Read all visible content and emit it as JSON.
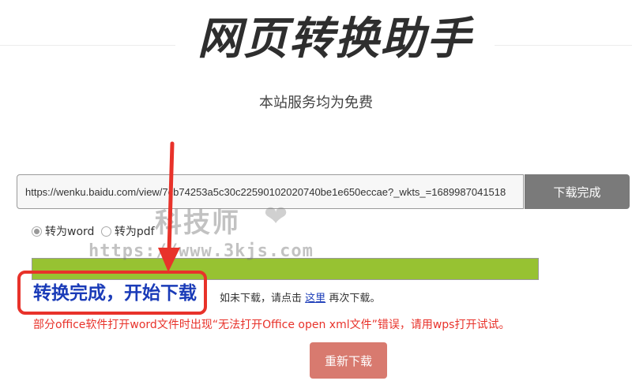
{
  "header": {
    "title": "网页转换助手",
    "subtitle": "本站服务均为免费"
  },
  "form": {
    "url_value": "https://wenku.baidu.com/view/7cb74253a5c30c22590102020740be1e650eccae?_wkts_=1689987041518",
    "download_label": "下载完成",
    "options": [
      {
        "label": "转为word",
        "checked": true
      },
      {
        "label": "转为pdf",
        "checked": false
      }
    ],
    "progress_fraction": 1.0
  },
  "result": {
    "done_text": "转换完成，开始下载",
    "retry_prefix": "如未下载，请点击",
    "retry_link": "这里",
    "retry_suffix": "再次下载。",
    "warning": "部分office软件打开word文件时出现“无法打开Office open xml文件”错误，请用wps打开试试。",
    "reload_label": "重新下载"
  },
  "watermark": {
    "text": "科技师",
    "heart": "❤",
    "url": "https://www.3kjs.com"
  },
  "colors": {
    "progress": "#97c232",
    "highlight_red": "#e8322a",
    "link_blue": "#1a3bb8"
  }
}
